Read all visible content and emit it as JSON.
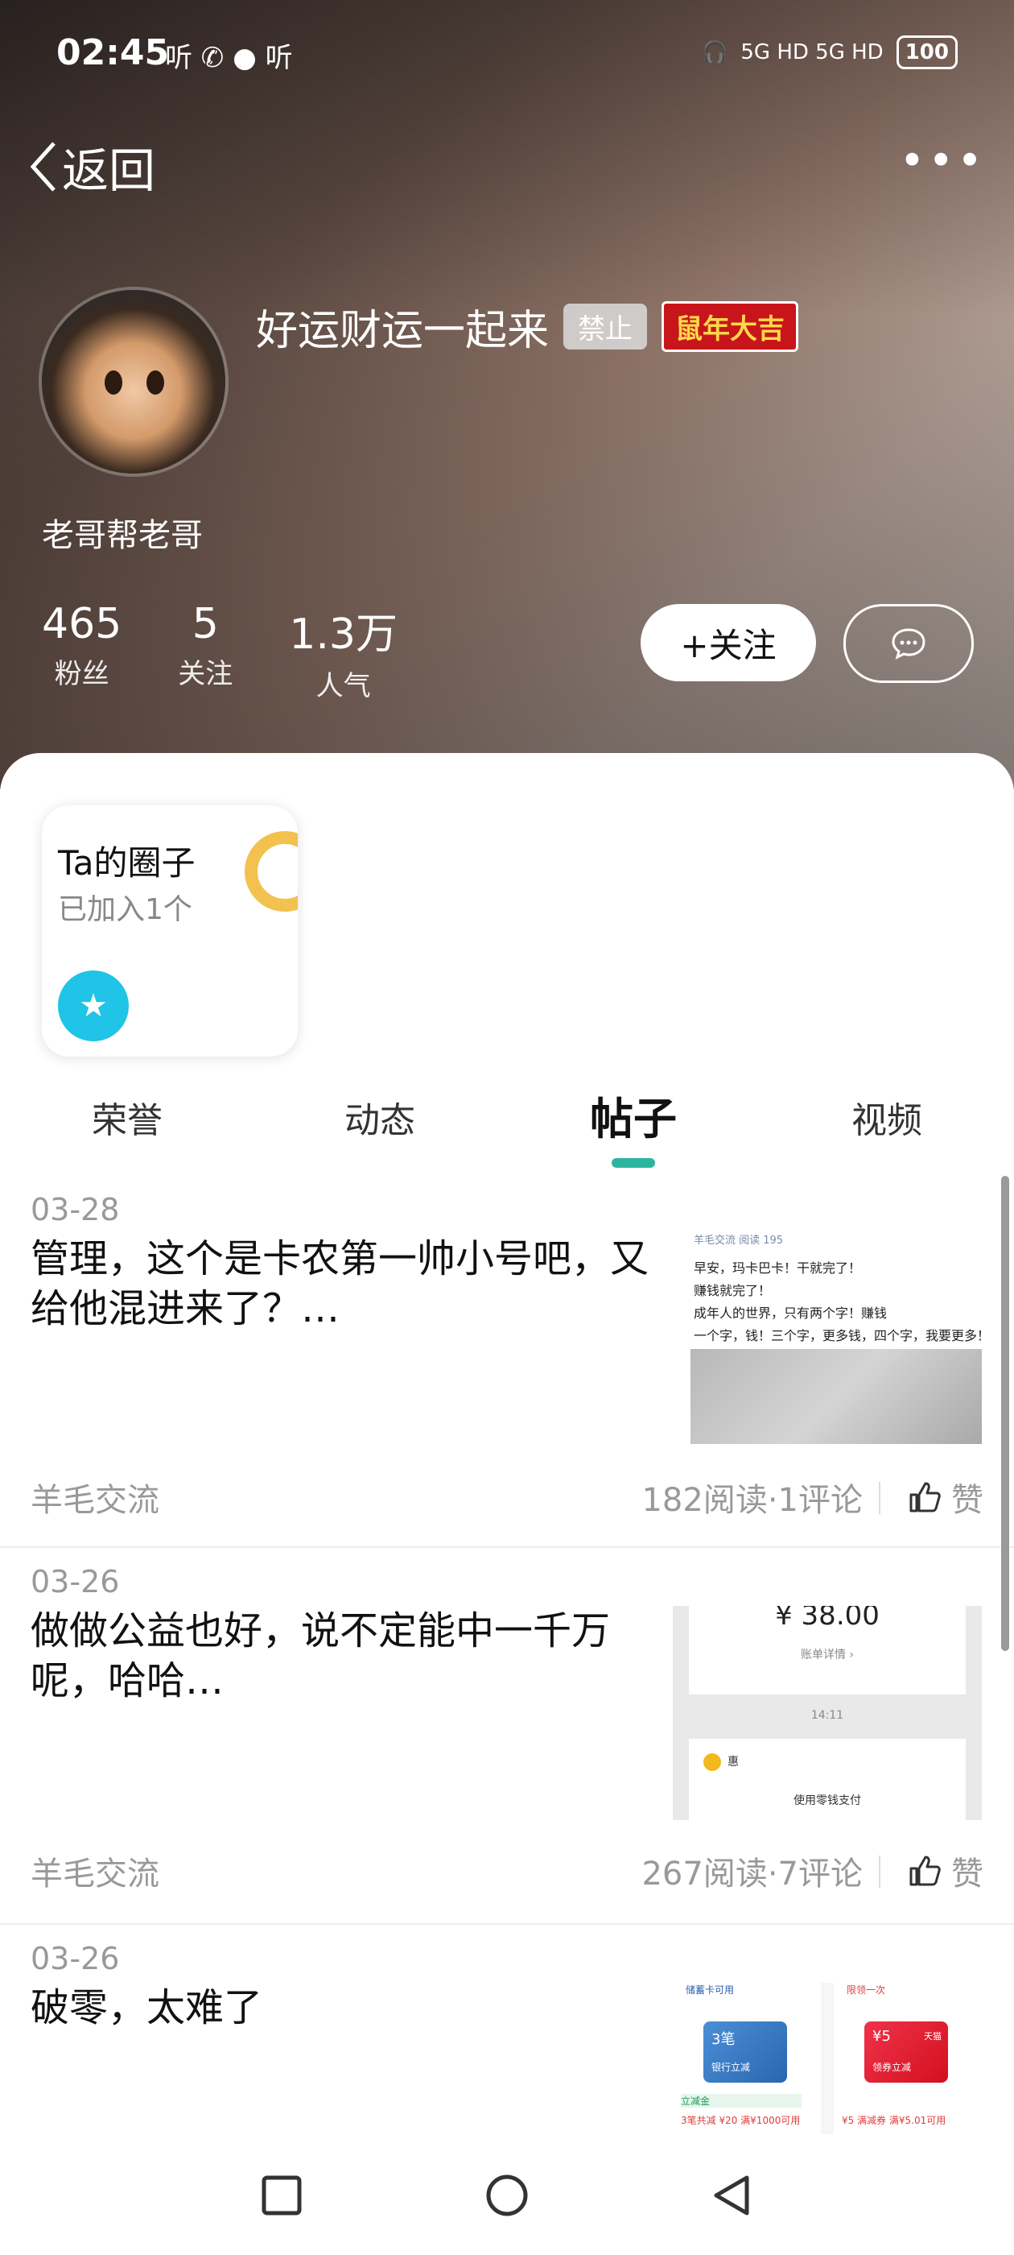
{
  "status_bar": {
    "time": "02:45",
    "battery": "100",
    "left_icons": "听 ✆ ● 听",
    "right_icons": "5G HD 5G HD"
  },
  "nav": {
    "back_label": "返回",
    "more_icon": "more-dots-icon"
  },
  "profile": {
    "nickname": "好运财运一起来",
    "ban_badge": "禁止",
    "medal_text": "鼠年大吉",
    "bio": "老哥帮老哥",
    "stats": [
      {
        "value": "465",
        "label": "粉丝"
      },
      {
        "value": "5",
        "label": "关注"
      },
      {
        "value": "1.3万",
        "label": "人气"
      }
    ],
    "follow_label": "+关注"
  },
  "circle_card": {
    "title": "Ta的圈子",
    "subtitle": "已加入1个"
  },
  "tabs": [
    {
      "label": "荣誉"
    },
    {
      "label": "动态"
    },
    {
      "label": "帖子"
    },
    {
      "label": "视频"
    }
  ],
  "posts": [
    {
      "date": "03-28",
      "text": "管理，这个是卡农第一帅小号吧，又给他混进来了？…",
      "category": "羊毛交流",
      "meta": "182阅读·1评论",
      "like": "赞",
      "thumb_lines": [
        "羊毛交流   阅读 195",
        "早安，玛卡巴卡！干就完了！",
        "赚钱就完了！",
        "成年人的世界，只有两个字！赚钱",
        "一个字，钱！三个字，更多钱，四个字，我要更多！"
      ]
    },
    {
      "date": "03-26",
      "text": "做做公益也好，说不定能中一千万呢，哈哈…",
      "category": "羊毛交流",
      "meta": "267阅读·7评论",
      "like": "赞",
      "thumb_lines": [
        "¥ 38.00",
        "账单详情 ›",
        "14:11",
        "惠",
        "使用零钱支付"
      ]
    },
    {
      "date": "03-26",
      "text": "破零，太难了",
      "thumb_lines": [
        "储蓄卡可用",
        "3笔",
        "银行立减",
        "立减金",
        "3笔共减 ¥20 满¥1000可用",
        "限领一次",
        "¥5",
        "天猫",
        "领券立减",
        "¥5 满减券 满¥5.01可用"
      ]
    }
  ],
  "colors": {
    "accent": "#2bb5a0",
    "folder_icon": "#1fc4e6",
    "ring": "#f2c14e",
    "medal_bg": "#c8151b"
  }
}
